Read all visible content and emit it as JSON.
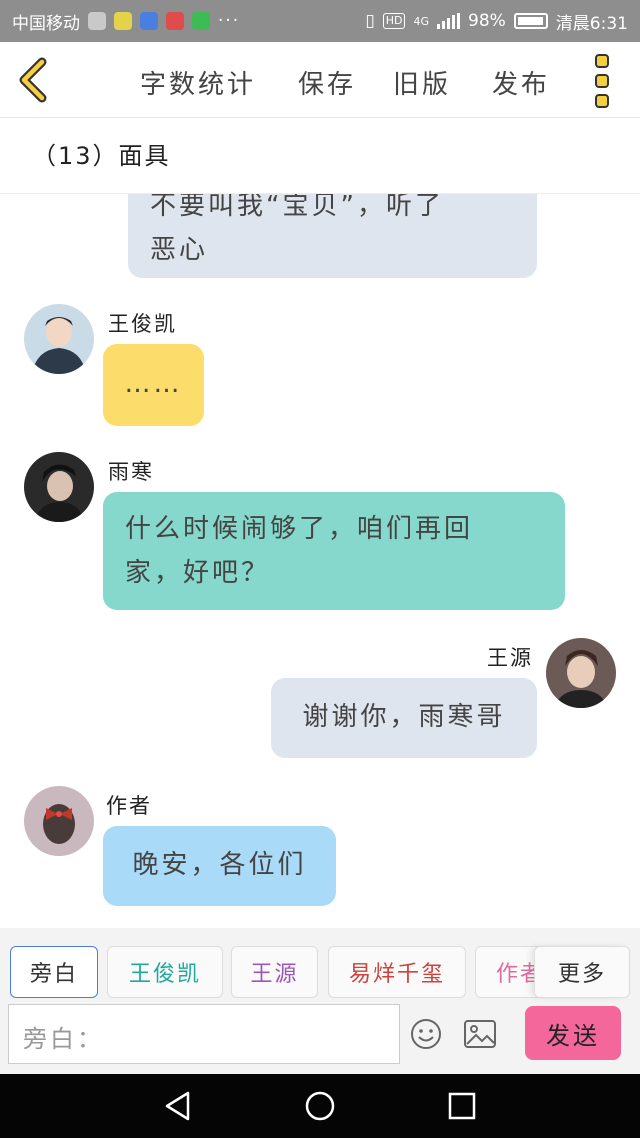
{
  "status_bar": {
    "carrier": "中国移动",
    "network": "4G",
    "hd_badge": "HD",
    "battery_percent": "98%",
    "time": "清晨6:31",
    "more": "···"
  },
  "toolbar": {
    "word_count": "字数统计",
    "save": "保存",
    "old_version": "旧版",
    "publish": "发布"
  },
  "chapter": {
    "title": "（13）面具"
  },
  "messages": [
    {
      "speaker": "",
      "text_lines": [
        "不要叫我“宝贝”，听了",
        "恶心"
      ],
      "color": "#dfe5ee"
    },
    {
      "speaker": "王俊凯",
      "text_lines": [
        "……"
      ],
      "color": "#fcdc6b"
    },
    {
      "speaker": "雨寒",
      "text_lines": [
        "什么时候闹够了，咱们再回",
        "家，好吧？"
      ],
      "color": "#86d8cc"
    },
    {
      "speaker": "王源",
      "text_lines": [
        "谢谢你，雨寒哥"
      ],
      "color": "#dfe5ee"
    },
    {
      "speaker": "作者",
      "text_lines": [
        "晚安，各位们"
      ],
      "color": "#a9daf8"
    }
  ],
  "roles": [
    {
      "label": "旁白",
      "color": "#333333"
    },
    {
      "label": "王俊凯",
      "color": "#1fa99b"
    },
    {
      "label": "王源",
      "color": "#9b59b6"
    },
    {
      "label": "易烊千玺",
      "color": "#d0413b"
    },
    {
      "label": "作者",
      "color": "#e06c9f"
    },
    {
      "label": "更多",
      "color": "#333333"
    }
  ],
  "input": {
    "placeholder": "旁白："
  },
  "send_label": "发送",
  "colors": {
    "accent_send": "#f3679a",
    "selected_role_border": "#4a7fd1"
  }
}
